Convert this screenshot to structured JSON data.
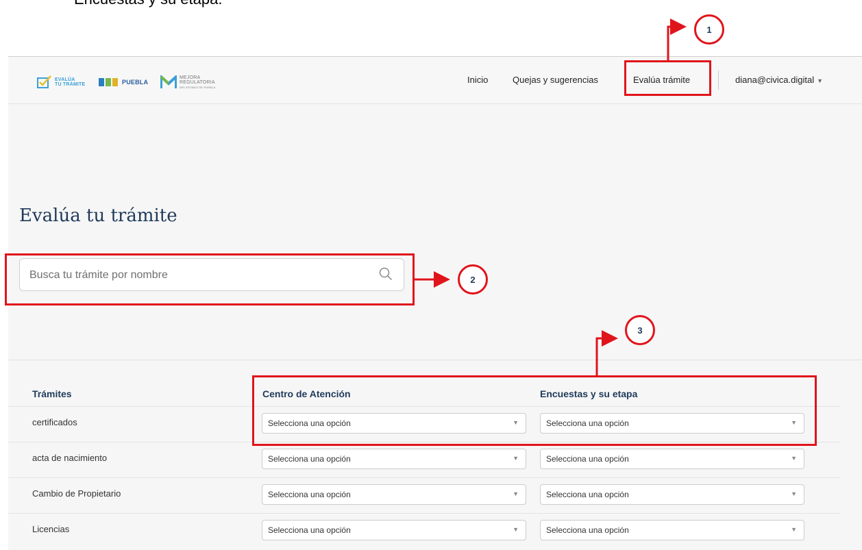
{
  "doc": {
    "caption": "Encuestas y su etapa."
  },
  "logos": {
    "evalua": {
      "line1": "EVALÚA",
      "line2": "TU TRÁMITE"
    },
    "puebla": {
      "line1": "PUEBLA"
    },
    "mejora": {
      "line1": "MEJORA",
      "line2": "REGULATORIA",
      "line3": "DEL ESTADO DE PUEBLA"
    }
  },
  "nav": {
    "inicio": "Inicio",
    "quejas": "Quejas y sugerencias",
    "evalua": "Evalúa trámite",
    "user": "diana@civica.digital"
  },
  "page": {
    "title": "Evalúa tu trámite"
  },
  "search": {
    "placeholder": "Busca tu trámite por nombre"
  },
  "table": {
    "headers": {
      "tramites": "Trámites",
      "centro": "Centro de Atención",
      "encuestas": "Encuestas y su etapa"
    },
    "rows": [
      {
        "name": "certificados",
        "centro": "Selecciona una opción",
        "encuestas": "Selecciona una opción"
      },
      {
        "name": "acta de nacimiento",
        "centro": "Selecciona una opción",
        "encuestas": "Selecciona una opción"
      },
      {
        "name": "Cambio de Propietario",
        "centro": "Selecciona una opción",
        "encuestas": "Selecciona una opción"
      },
      {
        "name": "Licencias",
        "centro": "Selecciona una opción",
        "encuestas": "Selecciona una opción"
      }
    ]
  },
  "annotations": {
    "c1": "1",
    "c2": "2",
    "c3": "3"
  },
  "colors": {
    "highlight": "#e0141b",
    "heading": "#1f3a5a",
    "background": "#f6f6f6"
  }
}
